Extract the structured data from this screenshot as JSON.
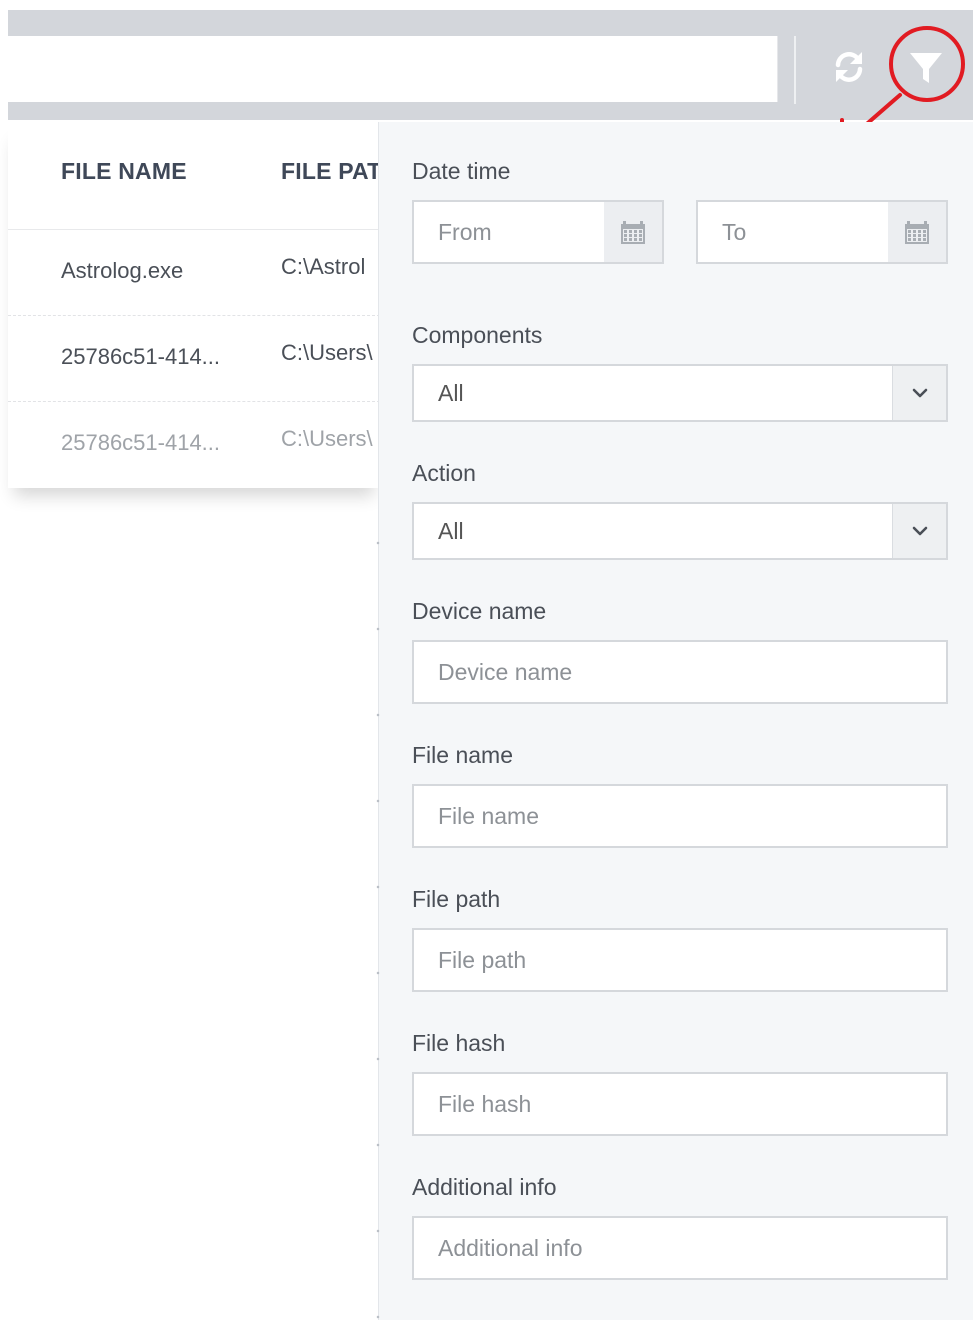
{
  "toolbar": {
    "refresh_icon": "refresh-icon",
    "filter_icon": "filter-icon",
    "accent": "#e11b22"
  },
  "table": {
    "headers": [
      "FILE NAME",
      "FILE PATH"
    ],
    "rows": [
      {
        "file_name": "Astrolog.exe",
        "file_path": "C:\\Astrol"
      },
      {
        "file_name": "25786c51-414...",
        "file_path": "C:\\Users\\"
      },
      {
        "file_name": "25786c51-414...",
        "file_path": "C:\\Users\\"
      }
    ]
  },
  "filters": {
    "date_time": {
      "label": "Date time",
      "from_placeholder": "From",
      "to_placeholder": "To"
    },
    "components": {
      "label": "Components",
      "value": "All"
    },
    "action": {
      "label": "Action",
      "value": "All"
    },
    "device_name": {
      "label": "Device name",
      "placeholder": "Device name"
    },
    "file_name": {
      "label": "File name",
      "placeholder": "File name"
    },
    "file_path": {
      "label": "File path",
      "placeholder": "File path"
    },
    "file_hash": {
      "label": "File hash",
      "placeholder": "File hash"
    },
    "additional_info": {
      "label": "Additional info",
      "placeholder": "Additional info"
    }
  }
}
